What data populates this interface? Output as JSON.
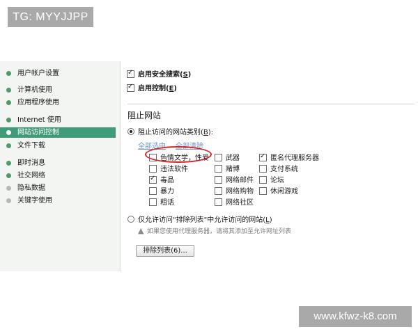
{
  "watermarks": {
    "top": "TG: MYYJJPP",
    "bottom": "www.kfwz-k8.com"
  },
  "sidebar": {
    "items": [
      {
        "label": "用户帐户设置"
      },
      {
        "label": "计算机使用"
      },
      {
        "label": "应用程序使用"
      },
      {
        "label": "Internet 使用"
      },
      {
        "label": "网站访问控制"
      },
      {
        "label": "文件下载"
      },
      {
        "label": "即时消息"
      },
      {
        "label": "社交网络"
      },
      {
        "label": "隐私数据"
      },
      {
        "label": "关键字使用"
      }
    ],
    "active": "网站访问控制"
  },
  "options": {
    "safe_search": {
      "label": "启用安全搜索(",
      "key": "S",
      "suffix": ")",
      "checked": true
    },
    "control": {
      "label": "启用控制(",
      "key": "E",
      "suffix": ")",
      "checked": true
    }
  },
  "block_section": {
    "title": "阻止网站",
    "radio_categories": {
      "label": "阻止访问的网站类别(",
      "key": "B",
      "suffix": "):",
      "checked": true
    },
    "select_all": "全部选中",
    "clear_all": "全部清除",
    "categories": [
      {
        "label": "色情文学，性爱",
        "checked": false
      },
      {
        "label": "武器",
        "checked": false
      },
      {
        "label": "匿名代理服务器",
        "checked": true
      },
      {
        "label": "违法软件",
        "checked": false
      },
      {
        "label": "赌博",
        "checked": false
      },
      {
        "label": "支付系统",
        "checked": false
      },
      {
        "label": "毒品",
        "checked": true
      },
      {
        "label": "网络邮件",
        "checked": false
      },
      {
        "label": "论坛",
        "checked": false
      },
      {
        "label": "暴力",
        "checked": false
      },
      {
        "label": "网络购物",
        "checked": false
      },
      {
        "label": "休闲游戏",
        "checked": false
      },
      {
        "label": "粗话",
        "checked": false
      },
      {
        "label": "网络社区",
        "checked": false
      }
    ],
    "radio_allowlist": {
      "label": "仅允许访问\"排除列表\"中允许访问的网站(",
      "key": "L",
      "suffix": ")",
      "checked": false
    },
    "proxy_note": "如果您使用代理服务器，请将其添加至允许网址列表",
    "exclusion_button": "排除列表(6)..."
  },
  "colors": {
    "active_nav": "#3f9b78",
    "nav_dot": "#4f9a66",
    "link": "#6d93c8",
    "highlight": "#d2262b"
  }
}
